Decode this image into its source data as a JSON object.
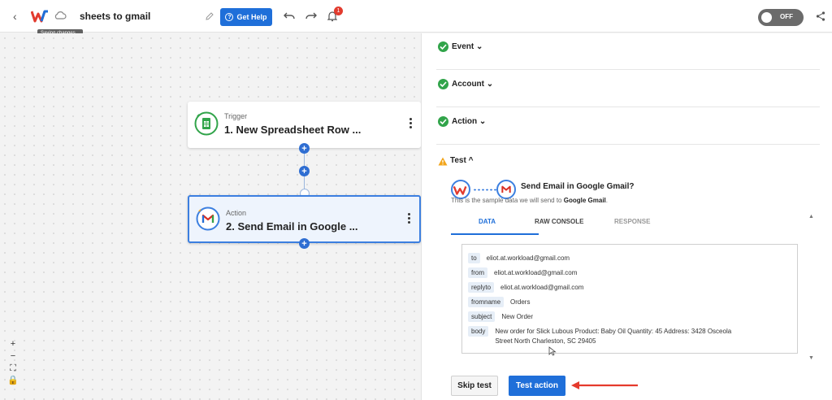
{
  "topbar": {
    "title": "sheets to gmail",
    "saving_tooltip": "Saving changes...",
    "get_help": "Get Help",
    "notification_count": "1",
    "toggle_label": "OFF"
  },
  "canvas": {
    "trigger": {
      "kind": "Trigger",
      "name": "1. New Spreadsheet Row ..."
    },
    "action": {
      "kind": "Action",
      "name": "2. Send Email in Google ..."
    },
    "zoom": [
      "+",
      "−",
      "⛶",
      "🔒"
    ]
  },
  "panel": {
    "sections": [
      "Event",
      "Account",
      "Action"
    ],
    "test": {
      "label": "Test",
      "flow_title": "Send Email in Google Gmail?",
      "flow_sub_prefix": "This is the sample data we will send to",
      "flow_sub_target": "Google Gmail",
      "tabs": [
        "DATA",
        "RAW CONSOLE",
        "RESPONSE"
      ],
      "fields": [
        {
          "key": "to",
          "value": "eliot.at.workload@gmail.com"
        },
        {
          "key": "from",
          "value": "eliot.at.workload@gmail.com"
        },
        {
          "key": "replyto",
          "value": "eliot.at.workload@gmail.com"
        },
        {
          "key": "fromname",
          "value": "Orders"
        },
        {
          "key": "subject",
          "value": "New Order"
        },
        {
          "key": "body",
          "value": "New order for Slick Lubous Product: Baby Oil Quantity: 45 Address: 3428 Osceola Street North Charleston, SC 29405"
        }
      ],
      "skip_label": "Skip test",
      "test_label": "Test action"
    }
  },
  "colors": {
    "accent": "#1f6fd9",
    "success": "#31a44a",
    "warning": "#f2a51c",
    "arrow": "#e53a2c"
  }
}
